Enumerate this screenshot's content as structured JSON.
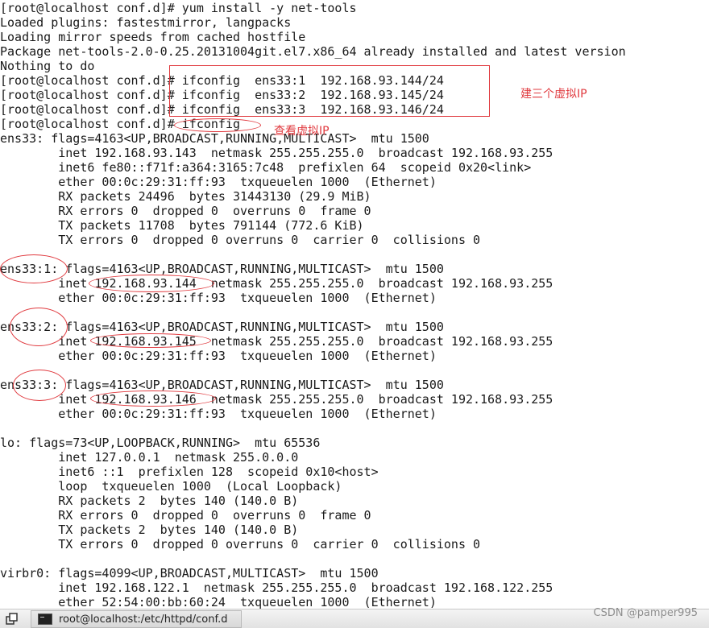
{
  "terminal": {
    "lines": [
      "[root@localhost conf.d]# yum install -y net-tools",
      "Loaded plugins: fastestmirror, langpacks",
      "Loading mirror speeds from cached hostfile",
      "Package net-tools-2.0-0.25.20131004git.el7.x86_64 already installed and latest version",
      "Nothing to do",
      "[root@localhost conf.d]# ifconfig  ens33:1  192.168.93.144/24",
      "[root@localhost conf.d]# ifconfig  ens33:2  192.168.93.145/24",
      "[root@localhost conf.d]# ifconfig  ens33:3  192.168.93.146/24",
      "[root@localhost conf.d]# ifconfig",
      "ens33: flags=4163<UP,BROADCAST,RUNNING,MULTICAST>  mtu 1500",
      "        inet 192.168.93.143  netmask 255.255.255.0  broadcast 192.168.93.255",
      "        inet6 fe80::f71f:a364:3165:7c48  prefixlen 64  scopeid 0x20<link>",
      "        ether 00:0c:29:31:ff:93  txqueuelen 1000  (Ethernet)",
      "        RX packets 24496  bytes 31443130 (29.9 MiB)",
      "        RX errors 0  dropped 0  overruns 0  frame 0",
      "        TX packets 11708  bytes 791144 (772.6 KiB)",
      "        TX errors 0  dropped 0 overruns 0  carrier 0  collisions 0",
      "",
      "ens33:1: flags=4163<UP,BROADCAST,RUNNING,MULTICAST>  mtu 1500",
      "        inet 192.168.93.144  netmask 255.255.255.0  broadcast 192.168.93.255",
      "        ether 00:0c:29:31:ff:93  txqueuelen 1000  (Ethernet)",
      "",
      "ens33:2: flags=4163<UP,BROADCAST,RUNNING,MULTICAST>  mtu 1500",
      "        inet 192.168.93.145  netmask 255.255.255.0  broadcast 192.168.93.255",
      "        ether 00:0c:29:31:ff:93  txqueuelen 1000  (Ethernet)",
      "",
      "ens33:3: flags=4163<UP,BROADCAST,RUNNING,MULTICAST>  mtu 1500",
      "        inet 192.168.93.146  netmask 255.255.255.0  broadcast 192.168.93.255",
      "        ether 00:0c:29:31:ff:93  txqueuelen 1000  (Ethernet)",
      "",
      "lo: flags=73<UP,LOOPBACK,RUNNING>  mtu 65536",
      "        inet 127.0.0.1  netmask 255.0.0.0",
      "        inet6 ::1  prefixlen 128  scopeid 0x10<host>",
      "        loop  txqueuelen 1000  (Local Loopback)",
      "        RX packets 2  bytes 140 (140.0 B)",
      "        RX errors 0  dropped 0  overruns 0  frame 0",
      "        TX packets 2  bytes 140 (140.0 B)",
      "        TX errors 0  dropped 0 overruns 0  carrier 0  collisions 0",
      "",
      "virbr0: flags=4099<UP,BROADCAST,MULTICAST>  mtu 1500",
      "        inet 192.168.122.1  netmask 255.255.255.0  broadcast 192.168.122.255",
      "        ether 52:54:00:bb:60:24  txqueuelen 1000  (Ethernet)"
    ]
  },
  "annotations": {
    "create_virtual_ip_label": "建三个虚拟IP",
    "view_virtual_ip_label": "查看虚拟IP",
    "color": "#e0393e"
  },
  "taskbar": {
    "task_label": "root@localhost:/etc/httpd/conf.d",
    "show_desktop_icon": "show-desktop-icon",
    "terminal_icon": "terminal-icon"
  },
  "watermark": {
    "text": "CSDN @pamper995"
  }
}
